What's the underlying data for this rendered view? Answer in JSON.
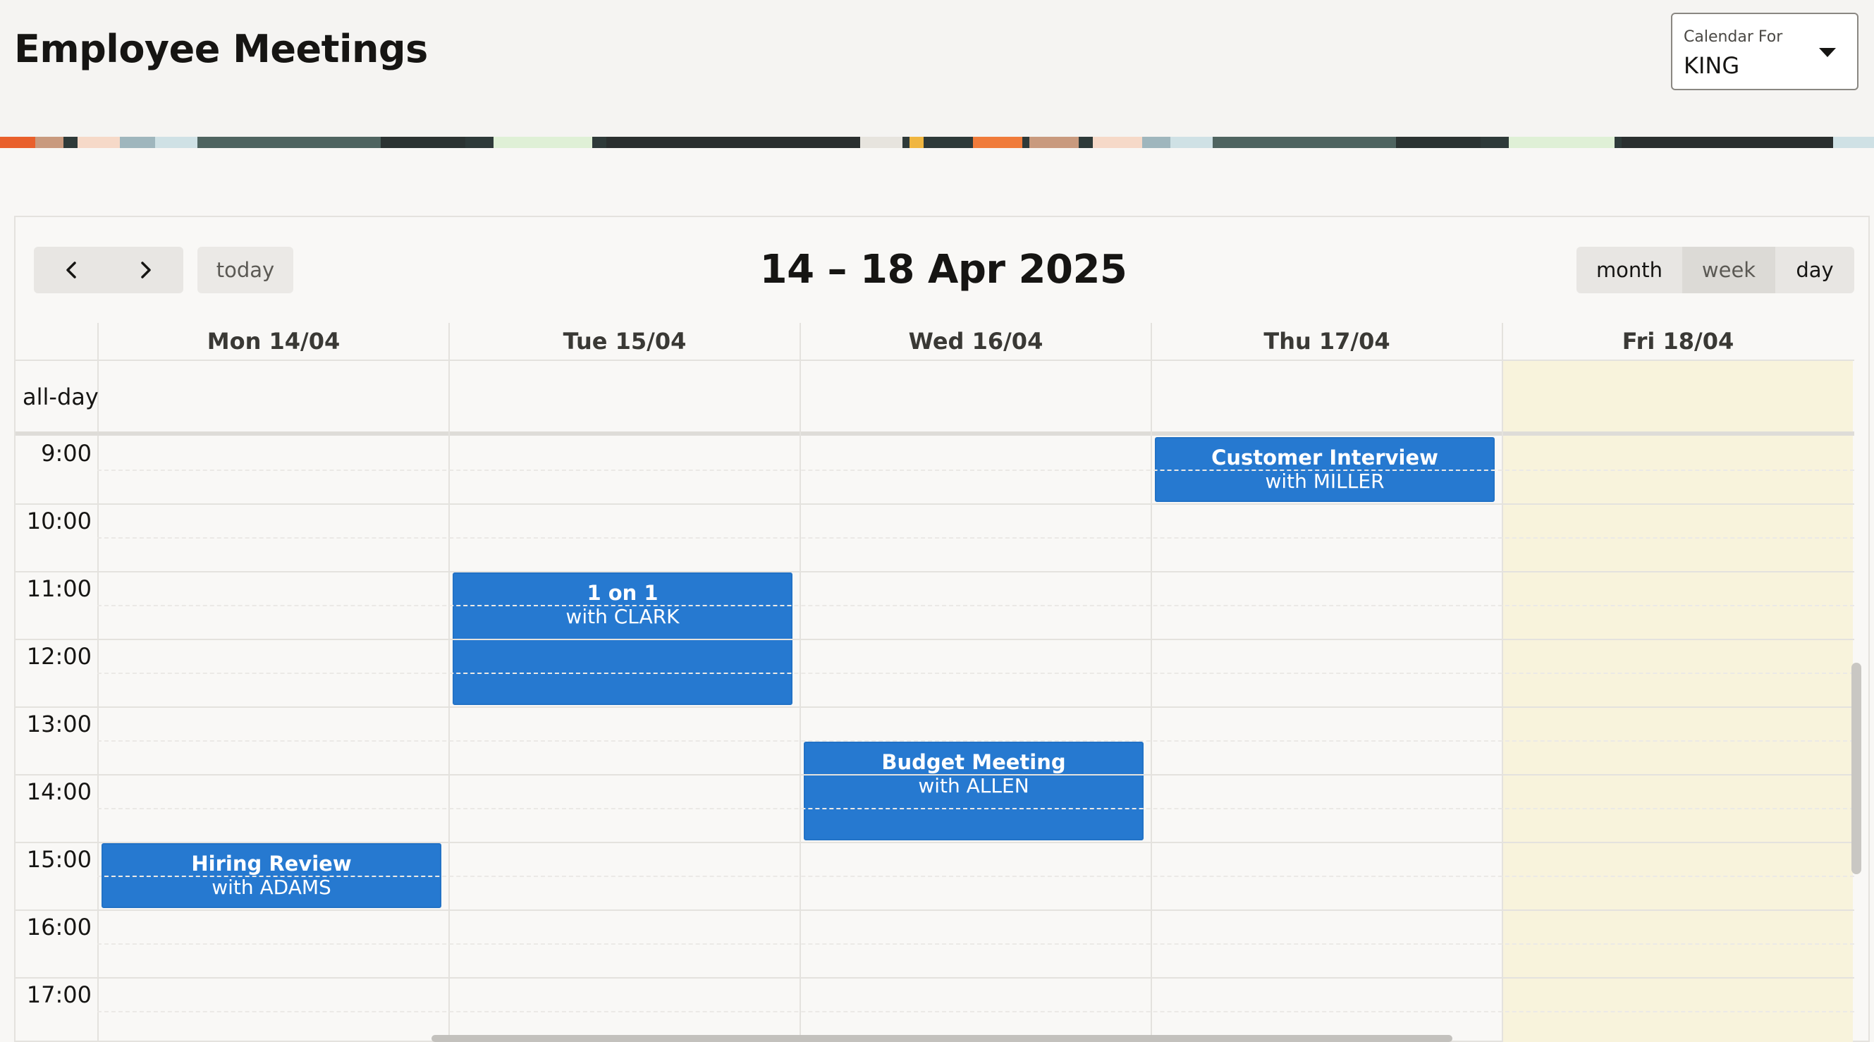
{
  "header": {
    "title": "Employee Meetings",
    "calendar_select": {
      "label": "Calendar For",
      "value": "KING"
    }
  },
  "toolbar": {
    "prev_icon": "chevron-left-icon",
    "next_icon": "chevron-right-icon",
    "today_label": "today",
    "range_title": "14 – 18 Apr 2025",
    "views": {
      "month": "month",
      "week": "week",
      "day": "day",
      "active": "week"
    }
  },
  "calendar": {
    "allday_label": "all-day",
    "days": [
      "Mon 14/04",
      "Tue 15/04",
      "Wed 16/04",
      "Thu 17/04",
      "Fri 18/04"
    ],
    "today": "Fri 18/04",
    "hours": [
      "9:00",
      "10:00",
      "11:00",
      "12:00",
      "13:00",
      "14:00",
      "15:00",
      "16:00",
      "17:00"
    ],
    "events": [
      {
        "title": "Customer Interview",
        "sub": "with MILLER",
        "day": "Thu 17/04",
        "start": "9:00",
        "end": "10:00"
      },
      {
        "title": "1 on 1",
        "sub": "with CLARK",
        "day": "Tue 15/04",
        "start": "11:00",
        "end": "13:00"
      },
      {
        "title": "Budget Meeting",
        "sub": "with ALLEN",
        "day": "Wed 16/04",
        "start": "13:30",
        "end": "15:00"
      },
      {
        "title": "Hiring Review",
        "sub": "with ADAMS",
        "day": "Mon 14/04",
        "start": "15:00",
        "end": "16:00"
      }
    ]
  },
  "colors": {
    "event": "#2679d0",
    "today_column": "#f8f3dc",
    "text": "#161513"
  }
}
